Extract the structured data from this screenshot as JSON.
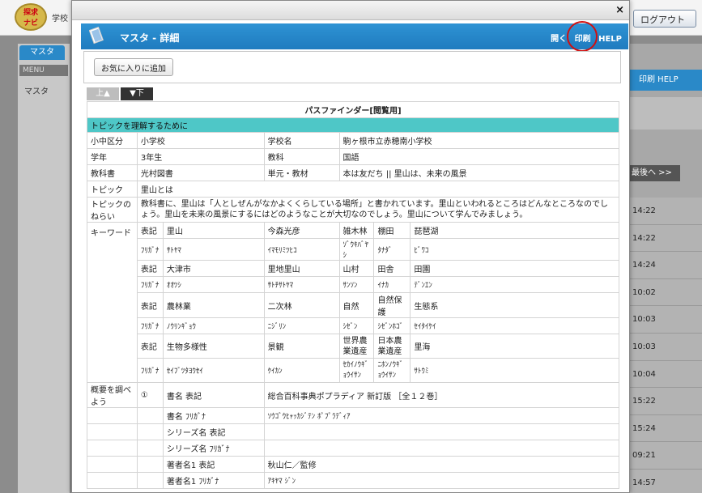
{
  "background": {
    "logo_text": "探求\nナビ",
    "school_label": "学校",
    "logout_label": "ログアウト",
    "master_tab": "マスタ",
    "menu_label": "MENU",
    "master_item": "マスタ",
    "right_bar": "印刷 HELP",
    "last_label": "最後へ >>",
    "times": [
      "14:22",
      "14:22",
      "14:24",
      "10:02",
      "10:03",
      "10:03",
      "10:04",
      "15:22",
      "15:24",
      "09:21",
      "14:57"
    ]
  },
  "modal": {
    "close": "×",
    "title": "マスタ - 詳細",
    "links": {
      "open": "開く",
      "print": "印刷",
      "help": "HELP"
    },
    "favorite_button": "お気に入りに追加",
    "tab_up": "上▲",
    "tab_down": "▼下",
    "table_title": "パスファインダー[閲覧用]",
    "section_topic": "トピックを理解するために",
    "rows": {
      "grade_division_label": "小中区分",
      "grade_division": "小学校",
      "school_name_label": "学校名",
      "school_name": "駒ヶ根市立赤穂南小学校",
      "year_label": "学年",
      "year": "3年生",
      "subject_label": "教科",
      "subject": "国語",
      "textbook_label": "教科書",
      "textbook": "光村図書",
      "unit_label": "単元・教材",
      "unit": "本は友だち || 里山は、未来の風景",
      "topic_label": "トピック",
      "topic": "里山とは",
      "aim_label": "トピックのねらい",
      "aim": "教科書に、里山は「人としぜんがなかよくくらしている場所」と書かれています。里山といわれるところはどんなところなのでしょう。里山を未来の風景にするにはどのようなことが大切なのでしょう。里山について学んでみましょう。",
      "keyword_label": "キーワード",
      "hyoki": "表記",
      "furigana": "ﾌﾘｶﾞﾅ",
      "kw": [
        {
          "hyoki": [
            "里山",
            "今森光彦",
            "雑木林",
            "棚田",
            "琵琶湖"
          ],
          "kana": [
            "ｻﾄﾔﾏ",
            "ｲﾏﾓﾘﾐﾂﾋｺ",
            "ｿﾞｳｷﾊﾞﾔｼ",
            "ﾀﾅﾀﾞ",
            "ﾋﾞﾜｺ"
          ]
        },
        {
          "hyoki": [
            "大津市",
            "里地里山",
            "山村",
            "田舎",
            "田園"
          ],
          "kana": [
            "ｵｵﾂｼ",
            "ｻﾄﾁｻﾄﾔﾏ",
            "ｻﾝｿﾝ",
            "ｲﾅｶ",
            "ﾃﾞﾝｴﾝ"
          ]
        },
        {
          "hyoki": [
            "農林業",
            "二次林",
            "自然",
            "自然保護",
            "生態系"
          ],
          "kana": [
            "ﾉｳﾘﾝｷﾞｮｳ",
            "ﾆｼﾞﾘﾝ",
            "ｼｾﾞﾝ",
            "ｼｾﾞﾝﾎｺﾞ",
            "ｾｲﾀｲｹｲ"
          ]
        },
        {
          "hyoki": [
            "生物多様性",
            "景観",
            "世界農業遺産",
            "日本農業遺産",
            "里海"
          ],
          "kana": [
            "ｾｲﾌﾞﾂﾀﾖｳｾｲ",
            "ｹｲｶﾝ",
            "ｾｶｲﾉｳｷﾞｮｳｲｻﾝ",
            "ﾆﾎﾝﾉｳｷﾞｮｳｲｻﾝ",
            "ｻﾄｳﾐ"
          ]
        }
      ],
      "overview_label": "概要を調べよう",
      "overview_num": "①",
      "book_title_label": "書名 表記",
      "book_title": "総合百科事典ポプラディア 新訂版 ［全１２巻］",
      "book_kana_label": "書名 ﾌﾘｶﾞﾅ",
      "book_kana": "ｿｳｺﾞｳﾋｬｯｶｼﾞﾃﾝ ﾎﾟﾌﾟﾗﾃﾞｨｱ",
      "series_label": "シリーズ名 表記",
      "series": "",
      "series_kana_label": "シリーズ名 ﾌﾘｶﾞﾅ",
      "series_kana": "",
      "author_label": "著者名1 表記",
      "author": "秋山仁／監修",
      "author_kana_label": "著者名1 ﾌﾘｶﾞﾅ",
      "author_kana": "ｱｷﾔﾏ ｼﾞﾝ"
    }
  },
  "colors": {
    "header_blue": "#1f7bbf",
    "section_teal": "#4ec7c7",
    "print_ring": "#d01010"
  }
}
